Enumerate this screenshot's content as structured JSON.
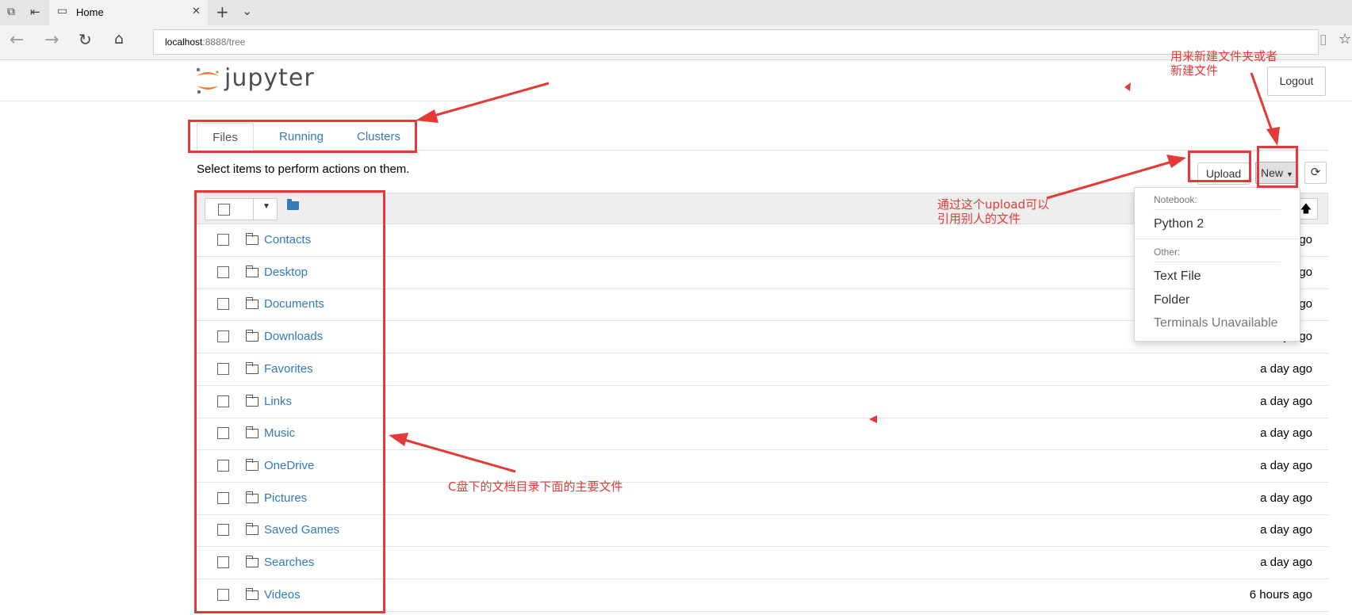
{
  "browser": {
    "tab_title": "Home",
    "new_tab_icon": "+",
    "tab_menu_icon": "⌄",
    "close_tab_icon": "✕",
    "address": "localhost:8888/tree",
    "address_host": "localhost",
    "address_rest": ":8888/tree"
  },
  "header": {
    "logo_text": "jupyter",
    "logout_label": "Logout"
  },
  "tabs": [
    {
      "label": "Files"
    },
    {
      "label": "Running"
    },
    {
      "label": "Clusters"
    }
  ],
  "toolbar": {
    "select_message": "Select items to perform actions on them.",
    "upload_label": "Upload",
    "new_label": "New",
    "refresh_icon": "refresh-icon"
  },
  "new_menu": {
    "notebook_header": "Notebook:",
    "notebook_items": [
      "Python 2"
    ],
    "other_header": "Other:",
    "other_items": [
      "Text File",
      "Folder"
    ],
    "disabled_item": "Terminals Unavailable"
  },
  "files": [
    {
      "name": "Contacts",
      "modified": "a day ago"
    },
    {
      "name": "Desktop",
      "modified": "a day ago"
    },
    {
      "name": "Documents",
      "modified": "a day ago"
    },
    {
      "name": "Downloads",
      "modified": "a day ago"
    },
    {
      "name": "Favorites",
      "modified": "a day ago"
    },
    {
      "name": "Links",
      "modified": "a day ago"
    },
    {
      "name": "Music",
      "modified": "a day ago"
    },
    {
      "name": "OneDrive",
      "modified": "a day ago"
    },
    {
      "name": "Pictures",
      "modified": "a day ago"
    },
    {
      "name": "Saved Games",
      "modified": "a day ago"
    },
    {
      "name": "Searches",
      "modified": "a day ago"
    },
    {
      "name": "Videos",
      "modified": "6 hours ago"
    }
  ],
  "annotations": {
    "new_note_line1": "用来新建文件夹或者",
    "new_note_line2": "新建文件",
    "upload_note_line1": "通过这个upload可以",
    "upload_note_line2": "引用别人的文件",
    "files_note": "C盘下的文档目录下面的主要文件"
  },
  "colors": {
    "link": "#337ab7",
    "annotation": "#e53935",
    "logo_orange": "#f37726"
  }
}
